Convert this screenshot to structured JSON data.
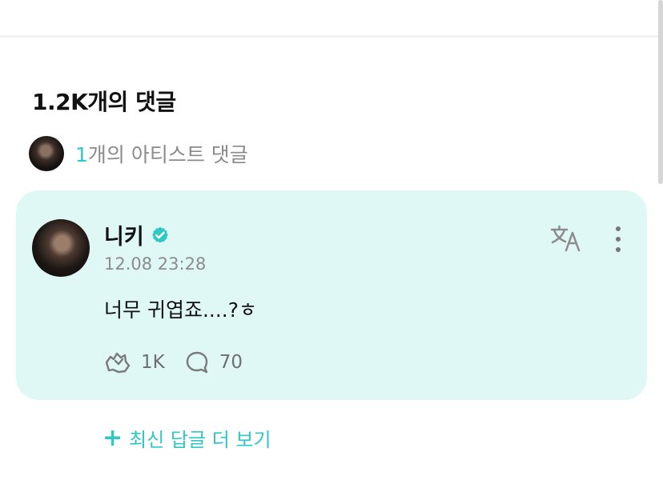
{
  "comments_section": {
    "title": "1.2K개의 댓글",
    "artist_comments": {
      "count": "1",
      "label": "개의 아티스트 댓글"
    }
  },
  "comment": {
    "author": "니키",
    "timestamp": "12.08 23:28",
    "text": "너무 귀엽죠....?ㅎ",
    "likes": "1K",
    "replies": "70",
    "verified_icon": "verified-check-icon",
    "translate_icon": "translate-icon",
    "more_icon": "more-vertical-icon"
  },
  "more_replies": {
    "label": "최신 답글 더 보기"
  },
  "colors": {
    "accent": "#2ec8c5",
    "card_background": "#dff8f5",
    "muted_text": "#8c8c8c",
    "text": "#111111"
  }
}
